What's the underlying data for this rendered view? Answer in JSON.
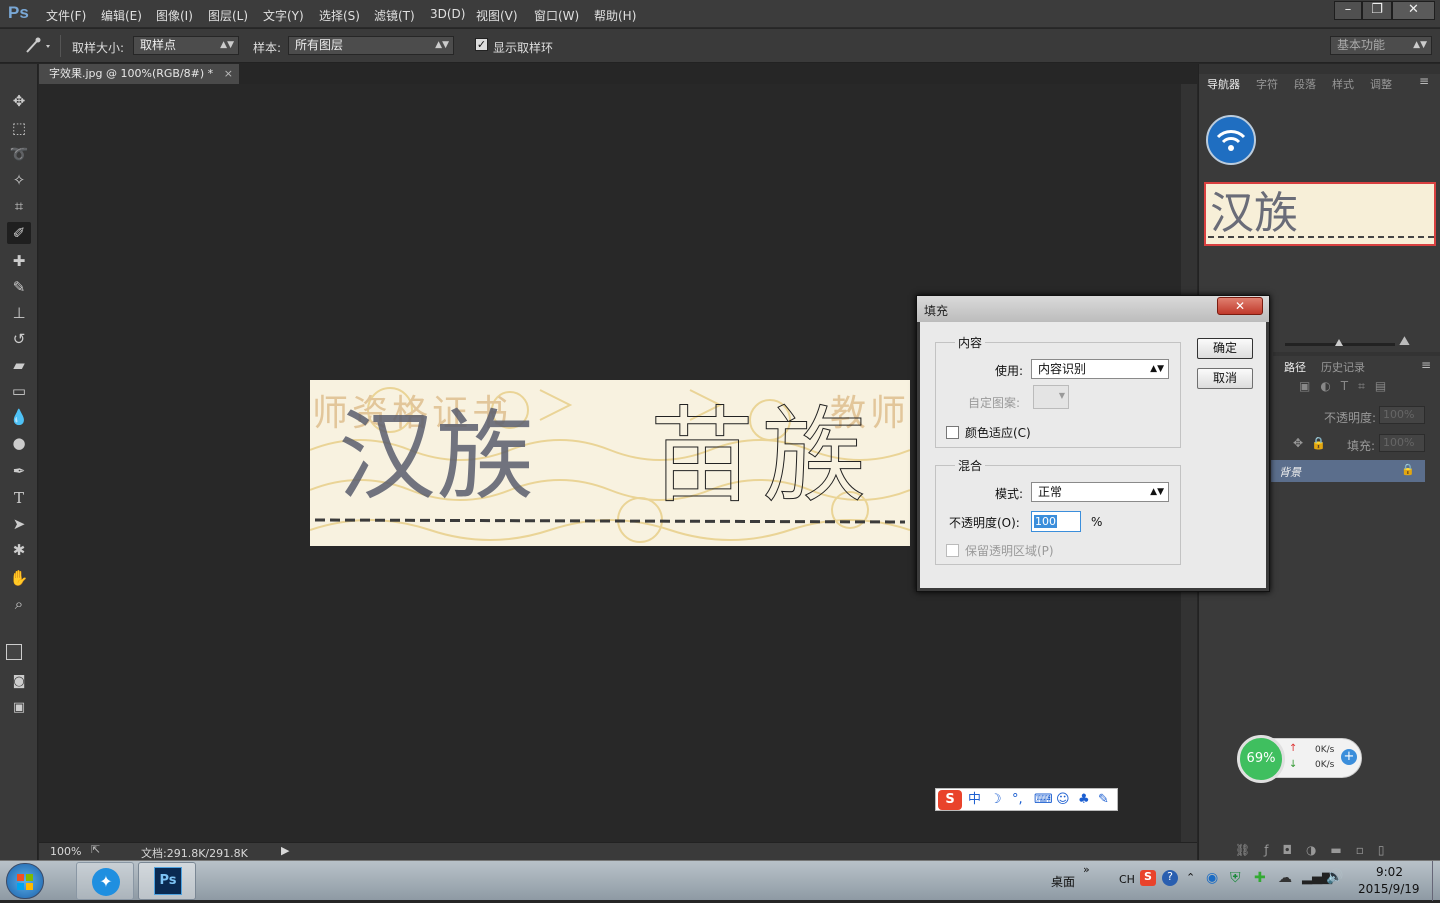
{
  "app": {
    "logo": "Ps"
  },
  "menu": [
    "文件(F)",
    "编辑(E)",
    "图像(I)",
    "图层(L)",
    "文字(Y)",
    "选择(S)",
    "滤镜(T)",
    "3D(D)",
    "视图(V)",
    "窗口(W)",
    "帮助(H)"
  ],
  "window_controls": {
    "minimize": "–",
    "restore": "❐",
    "close": "✕"
  },
  "options": {
    "sample_size_label": "取样大小:",
    "sample_size_value": "取样点",
    "sample_label": "样本:",
    "sample_value": "所有图层",
    "show_ring_label": "显示取样环",
    "show_ring_checked": true,
    "workspace": "基本功能"
  },
  "document": {
    "tab_title": "字效果.jpg @ 100%(RGB/8#) *",
    "close": "×",
    "zoom": "100%",
    "doc_info": "文档:291.8K/291.8K"
  },
  "canvas_text": {
    "left": "汉族",
    "right": "苗族",
    "bg_tokens": [
      "师",
      "资",
      "格",
      "证",
      "书",
      "教",
      "师"
    ]
  },
  "right_panel": {
    "top_tabs": [
      "导航器",
      "字符",
      "段落",
      "样式",
      "调整"
    ],
    "layer_tabs": [
      "路径",
      "历史记录"
    ],
    "opacity_label": "不透明度:",
    "opacity_value": "100%",
    "fill_label": "填充:",
    "fill_value": "100%",
    "layer_name": "背景"
  },
  "dialog": {
    "title": "填充",
    "contents_group": "内容",
    "use_label": "使用:",
    "use_value": "内容识别",
    "custom_pattern_label": "自定图案:",
    "color_adapt_label": "颜色适应(C)",
    "blend_group": "混合",
    "mode_label": "模式:",
    "mode_value": "正常",
    "opacity_label": "不透明度(O):",
    "opacity_value": "100",
    "percent": "%",
    "preserve_label": "保留透明区域(P)",
    "ok": "确定",
    "cancel": "取消",
    "close_glyph": "✕"
  },
  "net_widget": {
    "percent": "69%",
    "up": "0K/s",
    "down": "0K/s"
  },
  "ime_bar": {
    "lang": "中"
  },
  "taskbar": {
    "desktop_label": "桌面",
    "lang": "CH",
    "time": "9:02",
    "date": "2015/9/19"
  },
  "colors": {
    "accent": "#3b8edb",
    "ps_blue": "#0a2a52",
    "widget_green": "#3fbf5f"
  }
}
